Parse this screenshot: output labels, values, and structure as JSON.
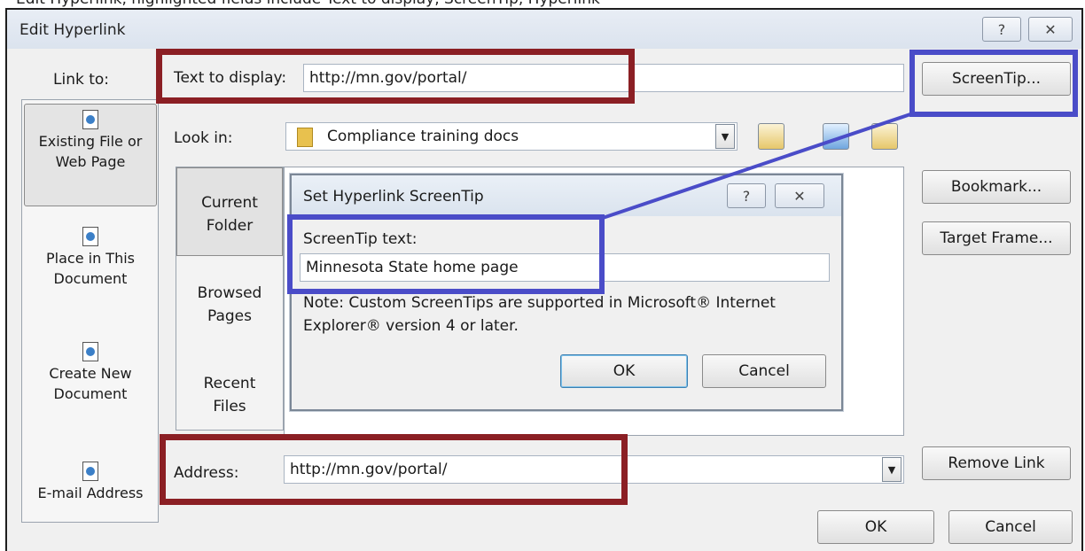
{
  "caption": "Edit Hyperlink, highlighted fields include Text to display, ScreenTip, Hyperlink",
  "window": {
    "title": "Edit Hyperlink",
    "help_glyph": "?",
    "close_glyph": "✕"
  },
  "link_to": {
    "label": "Link to:",
    "items": [
      {
        "line1": "Existing File or",
        "line2": "Web Page",
        "icon": "web-page-icon"
      },
      {
        "line1": "Place in This",
        "line2": "Document",
        "icon": "place-in-document-icon"
      },
      {
        "line1": "Create New",
        "line2": "Document",
        "icon": "new-document-icon"
      },
      {
        "line1": "E-mail Address",
        "line2": "",
        "icon": "email-icon"
      }
    ]
  },
  "text_to_display": {
    "label": "Text to display:",
    "value": "http://mn.gov/portal/"
  },
  "screentip_button": "ScreenTip...",
  "look_in": {
    "label": "Look in:",
    "value": "Compliance training docs"
  },
  "browse_tabs": [
    {
      "line1": "Current",
      "line2": "Folder"
    },
    {
      "line1": "Browsed",
      "line2": "Pages"
    },
    {
      "line1": "Recent",
      "line2": "Files"
    }
  ],
  "right_buttons": {
    "bookmark": "Bookmark...",
    "target_frame": "Target Frame...",
    "remove_link": "Remove Link"
  },
  "address": {
    "label": "Address:",
    "value": "http://mn.gov/portal/"
  },
  "footer": {
    "ok": "OK",
    "cancel": "Cancel"
  },
  "screentip_dialog": {
    "title": "Set Hyperlink ScreenTip",
    "field_label": "ScreenTip text:",
    "field_value": "Minnesota State home page",
    "note_line1": "Note: Custom ScreenTips are supported in Microsoft® Internet",
    "note_line2": "Explorer® version 4 or later.",
    "ok": "OK",
    "cancel": "Cancel"
  },
  "colors": {
    "highlight_red": "#8b1f24",
    "highlight_blue": "#4a4cc8"
  }
}
